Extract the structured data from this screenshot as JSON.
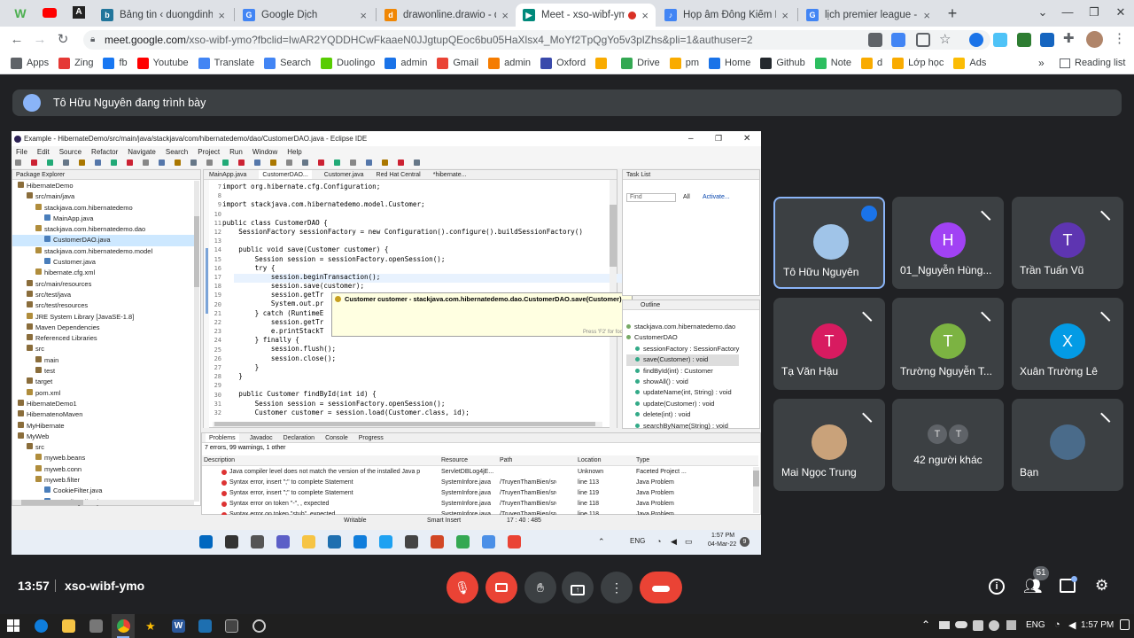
{
  "browser": {
    "tabs": [
      {
        "title": "Bảng tin ‹ duongdinh24",
        "icon": "wordpress-icon",
        "color": "#21759b"
      },
      {
        "title": "Google Dịch",
        "icon": "google-translate-icon",
        "color": "#4285f4"
      },
      {
        "title": "drawonline.drawio - diagrams",
        "icon": "drawio-icon",
        "color": "#f08705"
      },
      {
        "title": "Meet - xso-wibf-ymo",
        "icon": "google-meet-icon",
        "color": "#00897b"
      },
      {
        "title": "Họp âm Đông Kiếm Em",
        "icon": "music-icon",
        "color": "#4285f4"
      },
      {
        "title": "lịch premier league - Tìm",
        "icon": "google-icon",
        "color": "#4285f4"
      }
    ],
    "url_host": "meet.google.com",
    "url_rest": "/xso-wibf-ymo?fbclid=IwAR2YQDDHCwFkaaeN0JJgtupQEoc6bu05HaXlsx4_MoYf2TpQgYo5v3plZhs&pli=1&authuser=2",
    "bookmarks": [
      {
        "label": "Apps",
        "icon": "apps-grid-icon",
        "color": "#5f6368"
      },
      {
        "label": "Zing",
        "icon": "zing-icon",
        "color": "#e53935"
      },
      {
        "label": "fb",
        "icon": "facebook-icon",
        "color": "#1877f2"
      },
      {
        "label": "Youtube",
        "icon": "youtube-icon",
        "color": "#ff0000"
      },
      {
        "label": "Translate",
        "icon": "translate-icon",
        "color": "#4285f4"
      },
      {
        "label": "Search",
        "icon": "google-icon",
        "color": "#4285f4"
      },
      {
        "label": "Duolingo",
        "icon": "duolingo-icon",
        "color": "#58cc02"
      },
      {
        "label": "admin",
        "icon": "admin-icon",
        "color": "#1a73e8"
      },
      {
        "label": "Gmail",
        "icon": "gmail-icon",
        "color": "#ea4335"
      },
      {
        "label": "admin",
        "icon": "admin2-icon",
        "color": "#f57c00"
      },
      {
        "label": "Oxford",
        "icon": "oxford-icon",
        "color": "#3949ab"
      },
      {
        "label": "",
        "icon": "analytics-icon",
        "color": "#f9ab00"
      },
      {
        "label": "Drive",
        "icon": "drive-icon",
        "color": "#34a853"
      },
      {
        "label": "pm",
        "icon": "pm-icon",
        "color": "#f9ab00"
      },
      {
        "label": "Home",
        "icon": "home-icon",
        "color": "#1a73e8"
      },
      {
        "label": "Github",
        "icon": "github-icon",
        "color": "#24292e"
      },
      {
        "label": "Note",
        "icon": "note-icon",
        "color": "#2dbe60"
      },
      {
        "label": "d",
        "icon": "d-icon",
        "color": "#f9ab00"
      },
      {
        "label": "Lớp học",
        "icon": "classroom-icon",
        "color": "#f9ab00"
      },
      {
        "label": "Ads",
        "icon": "ads-icon",
        "color": "#fbbc04"
      }
    ],
    "reading_list": "Reading list",
    "more": "»"
  },
  "meet": {
    "presenter_text": "Tô Hữu Nguyên đang trình bày",
    "time": "13:57",
    "meeting_code": "xso-wibf-ymo",
    "participant_badge": "51",
    "tiles": [
      {
        "name": "Tô Hữu Nguyên",
        "initial": "",
        "color": "#a0c4e8",
        "speaking": true
      },
      {
        "name": "01_Nguyễn Hùng...",
        "initial": "H",
        "color": "#a142f4",
        "speaking": false
      },
      {
        "name": "Trần Tuấn Vũ",
        "initial": "T",
        "color": "#5e35b1",
        "speaking": false
      },
      {
        "name": "Tạ Văn Hậu",
        "initial": "T",
        "color": "#d81b60",
        "speaking": false
      },
      {
        "name": "Trường Nguyễn T...",
        "initial": "T",
        "color": "#7cb342",
        "speaking": false
      },
      {
        "name": "Xuân Trường Lê",
        "initial": "X",
        "color": "#039be5",
        "speaking": false
      },
      {
        "name": "Mai Ngọc Trung",
        "initial": "",
        "color": "#c9a27a",
        "speaking": false
      },
      {
        "name": "42 người khác",
        "initial": "T",
        "color": "#5f6368",
        "speaking": false
      },
      {
        "name": "Bạn",
        "initial": "",
        "color": "#4a6b8a",
        "speaking": false
      }
    ]
  },
  "eclipse": {
    "title": "Example - HibernateDemo/src/main/java/stackjava/com/hibernatedemo/dao/CustomerDAO.java - Eclipse IDE",
    "menu": [
      "File",
      "Edit",
      "Source",
      "Refactor",
      "Navigate",
      "Search",
      "Project",
      "Run",
      "Window",
      "Help"
    ],
    "package_explorer_title": "Package Explorer",
    "tree": [
      "HibernateDemo",
      "src/main/java",
      "stackjava.com.hibernatedemo",
      "MainApp.java",
      "stackjava.com.hibernatedemo.dao",
      "CustomerDAO.java",
      "stackjava.com.hibernatedemo.model",
      "Customer.java",
      "hibernate.cfg.xml",
      "src/main/resources",
      "src/test/java",
      "src/test/resources",
      "JRE System Library [JavaSE-1.8]",
      "Maven Dependencies",
      "Referenced Libraries",
      "src",
      "main",
      "test",
      "target",
      "pom.xml",
      "HibernateDemo1",
      "HibernatenoMaven",
      "MyHibernate",
      "MyWeb",
      "src",
      "myweb.beans",
      "myweb.conn",
      "myweb.filter",
      "CookieFilter.java",
      "EncodingFilter.java"
    ],
    "editor_tabs": [
      "MainApp.java",
      "CustomerDAO...",
      "Customer.java",
      "Red Hat Central",
      "*hibernate..."
    ],
    "line_numbers": [
      "7",
      "8",
      "9",
      "10",
      "11",
      "12",
      "13",
      "14",
      "15",
      "16",
      "17",
      "18",
      "19",
      "20",
      "21",
      "22",
      "23",
      "24",
      "25",
      "26",
      "27",
      "28",
      "29",
      "30",
      "31",
      "32"
    ],
    "code_lines": [
      "import org.hibernate.cfg.Configuration;",
      "",
      "import stackjava.com.hibernatedemo.model.Customer;",
      "",
      "public class CustomerDAO {",
      "    SessionFactory sessionFactory = new Configuration().configure().buildSessionFactory()",
      "",
      "    public void save(Customer customer) {",
      "        Session session = sessionFactory.openSession();",
      "        try {",
      "            session.beginTransaction();",
      "            session.save(customer);",
      "            session.getTr",
      "            System.out.pr",
      "        } catch (RuntimeE",
      "            session.getTr",
      "            e.printStackT",
      "        } finally {",
      "            session.flush();",
      "            session.close();",
      "        }",
      "    }",
      "",
      "    public Customer findById(int id) {",
      "        Session session = sessionFactory.openSession();",
      "        Customer customer = session.load(Customer.class, id);"
    ],
    "tooltip": "Customer customer - stackjava.com.hibernatedemo.dao.CustomerDAO.save(Customer)",
    "tooltip_hint": "Press 'F2' for focus",
    "task_list_title": "Task List",
    "find_placeholder": "Find",
    "all_label": "All",
    "activate_label": "Activate...",
    "outline_title": "Outline",
    "outline_items": [
      "stackjava.com.hibernatedemo.dao",
      "CustomerDAO",
      "sessionFactory : SessionFactory",
      "save(Customer) : void",
      "findById(int) : Customer",
      "showAll() : void",
      "updateName(int, String) : void",
      "update(Customer) : void",
      "delete(int) : void",
      "searchByName(String) : void"
    ],
    "bottom_tabs": [
      "Problems",
      "Javadoc",
      "Declaration",
      "Console",
      "Progress"
    ],
    "problems_summary": "7 errors, 99 warnings, 1 other",
    "problem_columns": [
      "Description",
      "Resource",
      "Path",
      "Location",
      "Type"
    ],
    "problem_rows": [
      [
        "Java compiler level does not match the version of the installed Java p",
        "ServletDBLog4jE...",
        "",
        "Unknown",
        "Faceted Project ..."
      ],
      [
        "Syntax error, insert \";\" to complete Statement",
        "SystemInfore.java",
        "/TruyenThamBien/src/...",
        "line 113",
        "Java Problem"
      ],
      [
        "Syntax error, insert \";\" to complete Statement",
        "SystemInfore.java",
        "/TruyenThamBien/src/...",
        "line 119",
        "Java Problem"
      ],
      [
        "Syntax error on token \"-\", , expected",
        "SystemInfore.java",
        "/TruyenThamBien/src/...",
        "line 118",
        "Java Problem"
      ],
      [
        "Syntax error on token \"stub\", expected",
        "SystemInfore.java",
        "/TruyenThamBien/src/...",
        "line 118",
        "Java Problem"
      ]
    ],
    "status_writable": "Writable",
    "status_insert": "Smart Insert",
    "status_pos": "17 : 40 : 485",
    "inner_taskbar": {
      "lang": "ENG",
      "time": "1:57 PM",
      "date": "04-Mar-22"
    }
  },
  "windows": {
    "lang": "ENG",
    "time": "1:57 PM"
  }
}
